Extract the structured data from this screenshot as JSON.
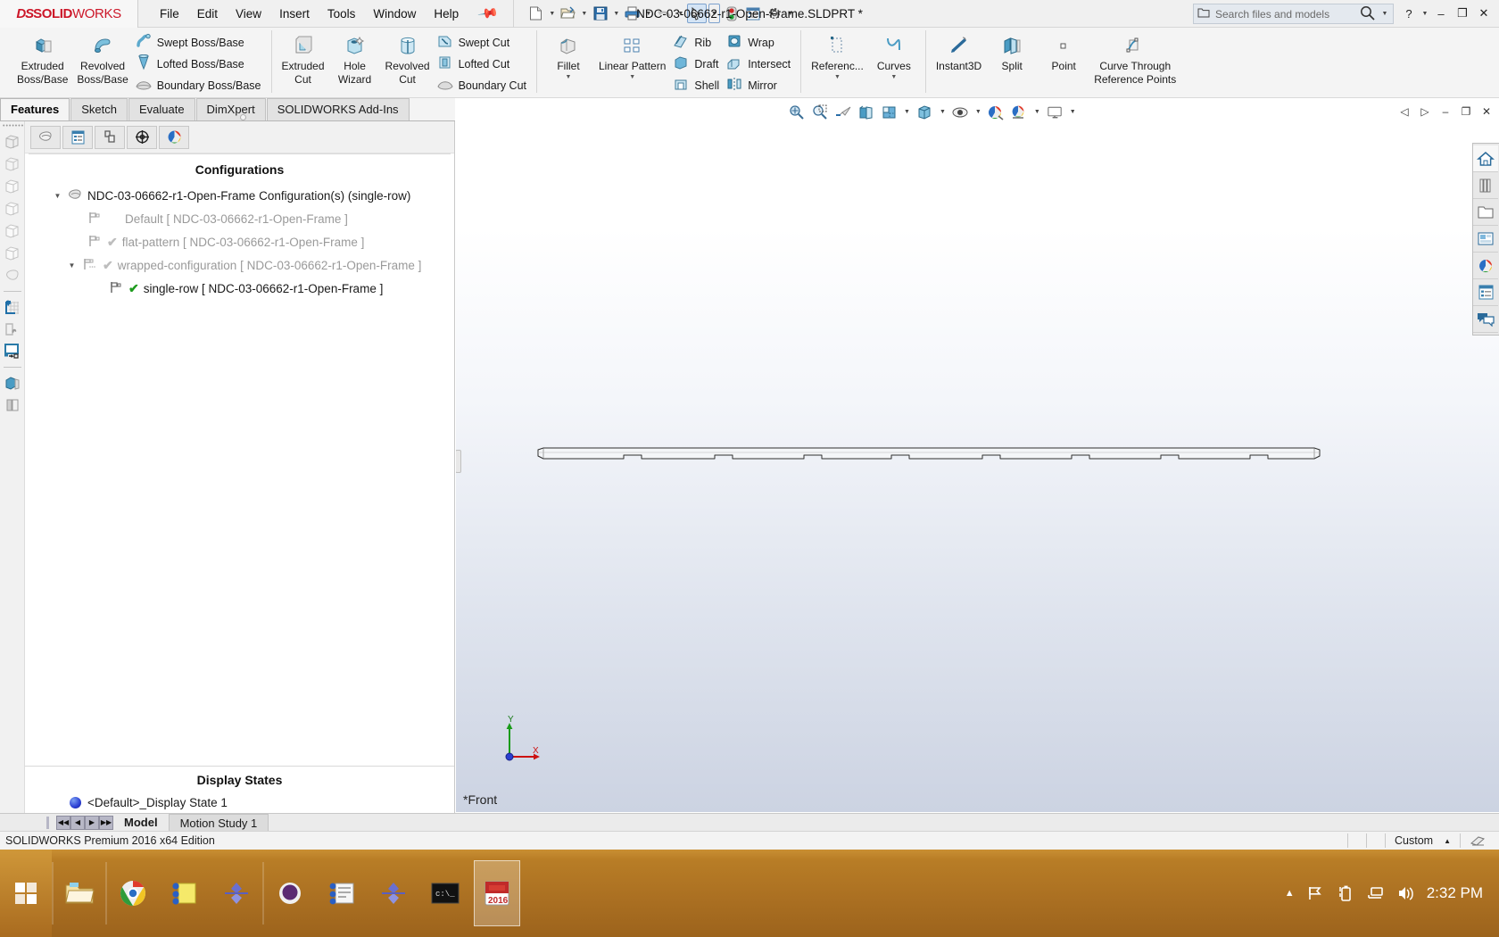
{
  "app": {
    "brand_ds": "DS",
    "brand_solid": "SOLID",
    "brand_works": "WORKS",
    "title": "NDC-03-06662-r1-Open-Frame.SLDPRT *",
    "edition": "SOLIDWORKS Premium 2016 x64 Edition",
    "accent": "#cc1628"
  },
  "menubar": {
    "items": [
      {
        "label": "File"
      },
      {
        "label": "Edit"
      },
      {
        "label": "View"
      },
      {
        "label": "Insert"
      },
      {
        "label": "Tools"
      },
      {
        "label": "Window"
      },
      {
        "label": "Help"
      }
    ]
  },
  "quick_access": {
    "items": [
      {
        "name": "new-document-icon",
        "caret": true
      },
      {
        "name": "open-document-icon",
        "caret": true
      },
      {
        "name": "save-icon",
        "caret": true
      },
      {
        "name": "print-icon",
        "caret": true
      },
      {
        "name": "undo-icon",
        "caret": true
      },
      {
        "name": "select-pointer-icon",
        "caret": true
      },
      {
        "name": "rebuild-icon",
        "caret": false
      },
      {
        "name": "options-list-icon",
        "caret": false
      },
      {
        "name": "settings-gear-icon",
        "caret": true
      }
    ]
  },
  "search": {
    "placeholder": "Search files and models",
    "value": ""
  },
  "window_buttons": {
    "help": "?",
    "minimize": "–",
    "restore": "❐",
    "close": "✕"
  },
  "ribbon": {
    "groups": [
      {
        "name": "boss-base-group",
        "big": [
          {
            "label": "Extruded\nBoss/Base",
            "icon": "extruded-boss-icon"
          },
          {
            "label": "Revolved\nBoss/Base",
            "icon": "revolved-boss-icon"
          }
        ],
        "small": [
          {
            "label": "Swept Boss/Base",
            "icon": "swept-boss-icon"
          },
          {
            "label": "Lofted Boss/Base",
            "icon": "lofted-boss-icon"
          },
          {
            "label": "Boundary Boss/Base",
            "icon": "boundary-boss-icon"
          }
        ]
      },
      {
        "name": "cut-group",
        "big": [
          {
            "label": "Extruded\nCut",
            "icon": "extruded-cut-icon"
          },
          {
            "label": "Hole\nWizard",
            "icon": "hole-wizard-icon"
          },
          {
            "label": "Revolved\nCut",
            "icon": "revolved-cut-icon"
          }
        ],
        "small": [
          {
            "label": "Swept Cut",
            "icon": "swept-cut-icon"
          },
          {
            "label": "Lofted Cut",
            "icon": "lofted-cut-icon"
          },
          {
            "label": "Boundary Cut",
            "icon": "boundary-cut-icon"
          }
        ]
      },
      {
        "name": "feature-group",
        "big": [
          {
            "label": "Fillet",
            "icon": "fillet-icon",
            "caret": true
          },
          {
            "label": "Linear Pattern",
            "icon": "linear-pattern-icon",
            "caret": true
          }
        ],
        "small": [
          {
            "label": "Rib",
            "icon": "rib-icon"
          },
          {
            "label": "Draft",
            "icon": "draft-icon"
          },
          {
            "label": "Shell",
            "icon": "shell-icon"
          }
        ],
        "small2": [
          {
            "label": "Wrap",
            "icon": "wrap-icon"
          },
          {
            "label": "Intersect",
            "icon": "intersect-icon"
          },
          {
            "label": "Mirror",
            "icon": "mirror-icon"
          }
        ]
      },
      {
        "name": "reference-group",
        "big": [
          {
            "label": "Referenc...",
            "icon": "reference-geometry-icon",
            "caret": true
          },
          {
            "label": "Curves",
            "icon": "curves-icon",
            "caret": true
          }
        ]
      },
      {
        "name": "tools-group",
        "big": [
          {
            "label": "Instant3D",
            "icon": "instant3d-icon"
          },
          {
            "label": "Split",
            "icon": "split-icon"
          },
          {
            "label": "Point",
            "icon": "point-icon"
          },
          {
            "label": "Curve Through\nReference Points",
            "icon": "curve-through-reference-points-icon"
          }
        ]
      }
    ]
  },
  "command_tabs": {
    "items": [
      {
        "label": "Features",
        "active": true
      },
      {
        "label": "Sketch",
        "active": false
      },
      {
        "label": "Evaluate",
        "active": false
      },
      {
        "label": "DimXpert",
        "active": false
      },
      {
        "label": "SOLIDWORKS Add-Ins",
        "active": false
      }
    ]
  },
  "left_rail": {
    "items": [
      {
        "name": "feature-manager-tree-icon"
      },
      {
        "name": "property-manager-icon"
      },
      {
        "name": "configuration-manager-icon"
      },
      {
        "name": "dimxpert-manager-icon"
      },
      {
        "name": "display-manager-icon"
      },
      {
        "name": "render-manager-icon"
      },
      {
        "name": "appearance-icon"
      },
      {
        "name": "sketch-tool-icon"
      },
      {
        "name": "tools-wrench-icon"
      },
      {
        "name": "display-pane-icon"
      },
      {
        "name": "part-solid-icon"
      },
      {
        "name": "panel-collapse-icon"
      }
    ]
  },
  "fm_toolbar": {
    "buttons": [
      {
        "name": "configuration-manager-tab-icon"
      },
      {
        "name": "property-manager-tab-icon"
      },
      {
        "name": "dimxpert-manager-tab-icon"
      },
      {
        "name": "display-manager-tab-icon"
      },
      {
        "name": "appearances-tab-icon"
      }
    ]
  },
  "configurations": {
    "header": "Configurations",
    "root": {
      "label": "NDC-03-06662-r1-Open-Frame Configuration(s)  (single-row)",
      "expanded": true,
      "icon": "configuration-root-icon"
    },
    "items": [
      {
        "label": "Default [ NDC-03-06662-r1-Open-Frame ]",
        "indent": 2,
        "dimmed": true,
        "check": false,
        "expander": false,
        "icon": "configuration-flag-icon"
      },
      {
        "label": "flat-pattern [ NDC-03-06662-r1-Open-Frame ]",
        "indent": 2,
        "dimmed": true,
        "check": true,
        "check_dim": true,
        "expander": false,
        "icon": "configuration-flag-icon"
      },
      {
        "label": "wrapped-configuration [ NDC-03-06662-r1-Open-Frame ]",
        "indent": 2,
        "dimmed": true,
        "check": true,
        "check_dim": true,
        "expander": true,
        "icon": "derived-configuration-icon"
      },
      {
        "label": "single-row [ NDC-03-06662-r1-Open-Frame ]",
        "indent": 3,
        "dimmed": false,
        "check": true,
        "check_dim": false,
        "expander": false,
        "icon": "configuration-flag-icon"
      }
    ]
  },
  "display_states": {
    "header": "Display States",
    "items": [
      {
        "label": "<Default>_Display State 1",
        "icon": "display-state-ball-icon"
      }
    ]
  },
  "viewport": {
    "view_label": "*Front",
    "triad": {
      "y_label": "Y",
      "x_label": "X"
    },
    "hud": [
      {
        "name": "zoom-to-fit-icon",
        "caret": false
      },
      {
        "name": "zoom-to-area-icon",
        "caret": false
      },
      {
        "name": "previous-view-icon",
        "caret": false
      },
      {
        "name": "section-view-icon",
        "caret": false
      },
      {
        "name": "view-orientation-icon",
        "caret": true
      },
      {
        "name": "display-style-icon",
        "caret": true
      },
      {
        "name": "hide-show-items-icon",
        "caret": true
      },
      {
        "name": "edit-appearance-icon",
        "caret": false
      },
      {
        "name": "apply-scene-icon",
        "caret": true
      },
      {
        "name": "view-settings-icon",
        "caret": true
      }
    ],
    "window_controls": [
      {
        "name": "restore-left-icon",
        "glyph": "◁"
      },
      {
        "name": "restore-right-icon",
        "glyph": "▷"
      },
      {
        "name": "minimize-doc-icon",
        "glyph": "–"
      },
      {
        "name": "restore-doc-icon",
        "glyph": "❐"
      },
      {
        "name": "close-doc-icon",
        "glyph": "✕"
      }
    ]
  },
  "task_pane": {
    "items": [
      {
        "name": "solidworks-resources-home-icon",
        "active": true
      },
      {
        "name": "design-library-icon",
        "active": false
      },
      {
        "name": "file-explorer-icon",
        "active": false
      },
      {
        "name": "view-palette-icon",
        "active": false
      },
      {
        "name": "appearances-scenes-decals-icon",
        "active": false
      },
      {
        "name": "custom-properties-icon",
        "active": false
      },
      {
        "name": "solidworks-forum-icon",
        "active": false
      }
    ]
  },
  "bottom_tabs": {
    "nav": [
      {
        "name": "first-tab-button",
        "glyph": "◀◀"
      },
      {
        "name": "prev-tab-button",
        "glyph": "◀"
      },
      {
        "name": "next-tab-button",
        "glyph": "▶"
      },
      {
        "name": "last-tab-button",
        "glyph": "▶▶"
      }
    ],
    "tabs": [
      {
        "label": "Model",
        "active": true
      },
      {
        "label": "Motion Study 1",
        "active": false
      }
    ]
  },
  "status_bar": {
    "left": "SOLIDWORKS Premium 2016 x64 Edition",
    "units": "Custom",
    "units_caret": "▲",
    "overlay_icon": "editing-part-icon"
  },
  "taskbar": {
    "start": {
      "name": "windows-start-icon"
    },
    "items": [
      {
        "name": "file-explorer-taskbar-icon",
        "active": false
      },
      {
        "name": "google-chrome-taskbar-icon",
        "active": false
      },
      {
        "name": "sticky-notes-taskbar-icon",
        "active": false
      },
      {
        "name": "plm-app-taskbar-icon",
        "active": false
      },
      {
        "name": "wine-app-taskbar-icon",
        "active": false
      },
      {
        "name": "notes-app-taskbar-icon",
        "active": false
      },
      {
        "name": "plm-app2-taskbar-icon",
        "active": false
      },
      {
        "name": "terminal-taskbar-icon",
        "active": false
      },
      {
        "name": "solidworks-2016-taskbar-icon",
        "active": true
      }
    ],
    "tray": {
      "expand": {
        "name": "show-hidden-icons-icon",
        "glyph": "▲"
      },
      "icons": [
        {
          "name": "action-center-flag-icon"
        },
        {
          "name": "battery-icon"
        },
        {
          "name": "network-icon"
        },
        {
          "name": "volume-icon"
        }
      ],
      "time": "2:32 PM"
    }
  }
}
